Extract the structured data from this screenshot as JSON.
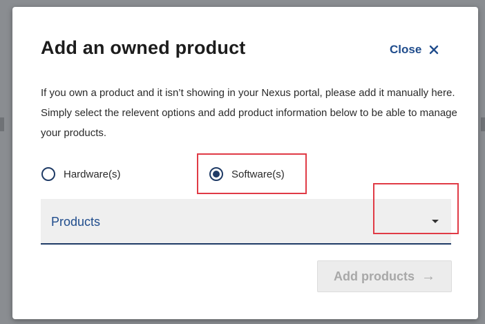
{
  "dialog": {
    "title": "Add an owned product",
    "close_label": "Close",
    "description": "If you own a product and it isn’t showing in your Nexus portal, please add it manually here. Simply select the relevent options and add product information below to be able to manage your products.",
    "product_type": {
      "options": [
        {
          "label": "Hardware(s)",
          "checked": false
        },
        {
          "label": "Software(s)",
          "checked": true
        }
      ]
    },
    "products_select": {
      "value": "Products"
    },
    "add_button": {
      "label": "Add products",
      "icon": "arrow-right-icon",
      "disabled": true
    }
  },
  "colors": {
    "primary": "#1f3b66",
    "link": "#1f4c8c",
    "highlight": "#e03a45",
    "disabled_text": "#a8a8a8"
  }
}
